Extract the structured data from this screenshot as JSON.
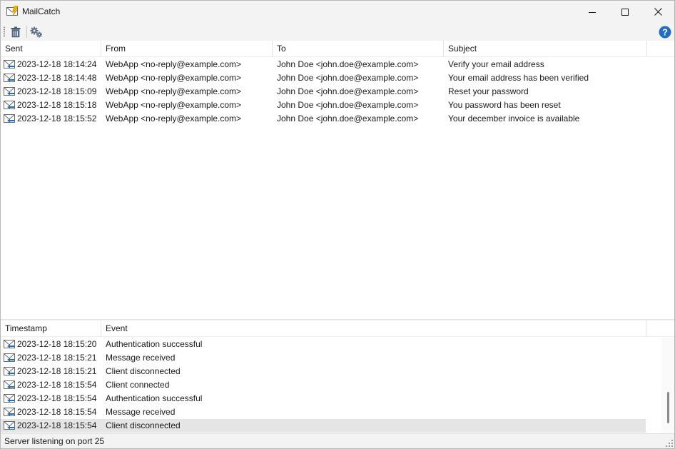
{
  "window": {
    "title": "MailCatch"
  },
  "toolbar": {
    "delete_icon": "trash-icon",
    "settings_icon": "gears-icon",
    "help_icon": "help-icon",
    "help_glyph": "?"
  },
  "messages": {
    "columns": [
      "Sent",
      "From",
      "To",
      "Subject"
    ],
    "rows": [
      {
        "sent": "2023-12-18 18:14:24",
        "from": "WebApp <no-reply@example.com>",
        "to": "John Doe <john.doe@example.com>",
        "subject": "Verify your email address"
      },
      {
        "sent": "2023-12-18 18:14:48",
        "from": "WebApp <no-reply@example.com>",
        "to": "John Doe <john.doe@example.com>",
        "subject": "Your email address has been verified"
      },
      {
        "sent": "2023-12-18 18:15:09",
        "from": "WebApp <no-reply@example.com>",
        "to": "John Doe <john.doe@example.com>",
        "subject": "Reset your password"
      },
      {
        "sent": "2023-12-18 18:15:18",
        "from": "WebApp <no-reply@example.com>",
        "to": "John Doe <john.doe@example.com>",
        "subject": "You password has been reset"
      },
      {
        "sent": "2023-12-18 18:15:52",
        "from": "WebApp <no-reply@example.com>",
        "to": "John Doe <john.doe@example.com>",
        "subject": "Your december invoice is available"
      }
    ]
  },
  "log": {
    "columns": [
      "Timestamp",
      "Event"
    ],
    "rows": [
      {
        "timestamp": "2023-12-18 18:15:20",
        "event": "Authentication successful"
      },
      {
        "timestamp": "2023-12-18 18:15:21",
        "event": "Message received"
      },
      {
        "timestamp": "2023-12-18 18:15:21",
        "event": "Client disconnected"
      },
      {
        "timestamp": "2023-12-18 18:15:54",
        "event": "Client connected"
      },
      {
        "timestamp": "2023-12-18 18:15:54",
        "event": "Authentication successful"
      },
      {
        "timestamp": "2023-12-18 18:15:54",
        "event": "Message received"
      },
      {
        "timestamp": "2023-12-18 18:15:54",
        "event": "Client disconnected"
      }
    ],
    "selected_row": 6
  },
  "status": {
    "text": "Server listening on port 25"
  },
  "colors": {
    "accent": "#1f6fc5",
    "selection": "#e5e5e5",
    "chrome": "#f3f3f3"
  }
}
